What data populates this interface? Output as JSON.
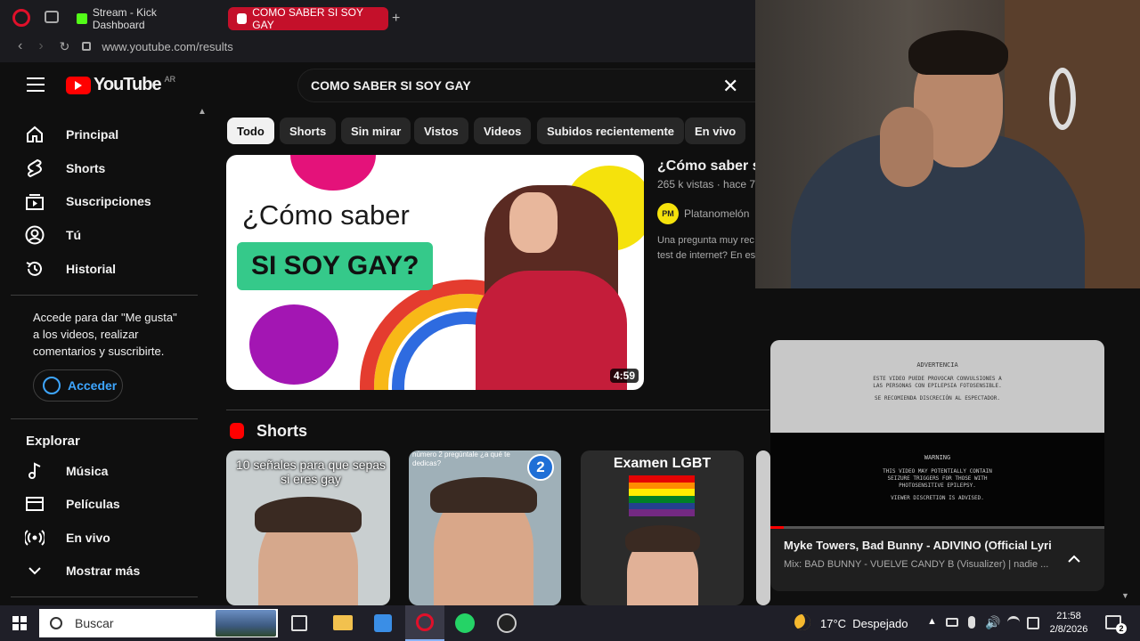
{
  "browser": {
    "tabs": [
      {
        "label": "Stream - Kick Dashboard"
      },
      {
        "label": "COMO SABER SI SOY GAY"
      }
    ],
    "new_tab": "+",
    "url": "www.youtube.com/results"
  },
  "youtube": {
    "logo_text": "YouTube",
    "region": "AR",
    "search_value": "COMO SABER SI SOY GAY",
    "sidebar": {
      "items": [
        {
          "label": "Principal"
        },
        {
          "label": "Shorts"
        },
        {
          "label": "Suscripciones"
        },
        {
          "label": "Tú"
        },
        {
          "label": "Historial"
        }
      ],
      "signin_text": "Accede para dar \"Me gusta\" a los videos, realizar comentarios y suscribirte.",
      "signin_button": "Acceder",
      "explore_title": "Explorar",
      "explore_items": [
        {
          "label": "Música"
        },
        {
          "label": "Películas"
        },
        {
          "label": "En vivo"
        },
        {
          "label": "Mostrar más"
        }
      ]
    },
    "chips": [
      "Todo",
      "Shorts",
      "Sin mirar",
      "Vistos",
      "Videos",
      "Subidos recientemente",
      "En vivo"
    ],
    "result": {
      "thumb_line1": "¿Cómo saber",
      "thumb_line2": "SI SOY GAY?",
      "duration": "4:59",
      "title": "¿Cómo saber s",
      "meta": "265 k vistas · hace 7 a",
      "channel": "Platanomelón",
      "channel_badge": "PM",
      "desc1": "Una pregunta muy rec",
      "desc2": "test de internet? En es"
    },
    "shorts_heading": "Shorts",
    "shorts": [
      {
        "caption": "10 señales para que sepas si eres gay"
      },
      {
        "caption": "número 2 pregúntale ¿a qué te dedicas?",
        "badge": "2"
      },
      {
        "caption": "Examen LGBT"
      }
    ]
  },
  "miniplayer": {
    "warning_es_title": "ADVERTENCIA",
    "warning_es_body": "ESTE VIDEO PUEDE PROVOCAR CONVULSIONES A LAS PERSONAS CON EPILEPSIA FOTOSENSIBLE.",
    "warning_es_note": "SE RECOMIENDA DISCRECIÓN AL ESPECTADOR.",
    "warning_en_title": "WARNING",
    "warning_en_body": "THIS VIDEO MAY POTENTIALLY CONTAIN SEIZURE TRIGGERS FOR THOSE WITH PHOTOSENSITIVE EPILEPSY.",
    "warning_en_note": "VIEWER DISCRETION IS ADVISED.",
    "title": "Myke Towers, Bad Bunny - ADIVINO (Official Lyri...",
    "subtitle": "Mix: BAD BUNNY - VUELVE CANDY B (Visualizer) | nadie ...",
    "progress": 0.04
  },
  "taskbar": {
    "search_label": "Buscar",
    "weather": "17°C  Despejado",
    "time": "21:58",
    "date": "2/8/2026",
    "notif_count": "2"
  }
}
